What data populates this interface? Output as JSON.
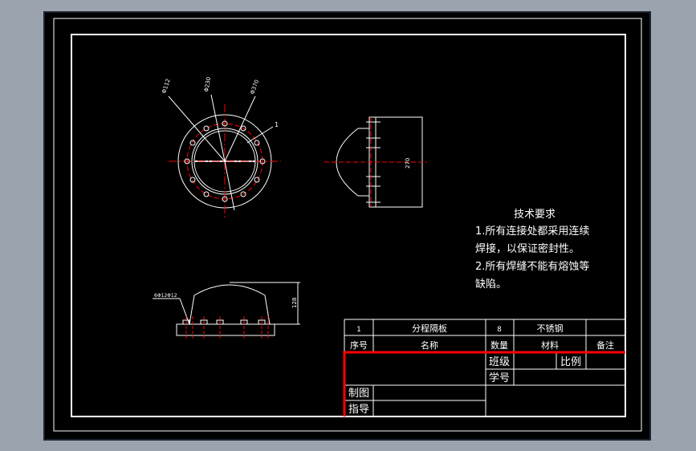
{
  "colors": {
    "viewer_background": "#9aa3ae",
    "sheet": "#000000",
    "lines": "#ffffff",
    "centerlines": "#ff0000",
    "highlight": "#ff0000"
  },
  "technical_requirements": {
    "title": "技术要求",
    "line1": "1.所有连接处都采用连续",
    "line2": "焊接，以保证密封性。",
    "line3": "2.所有焊缝不能有熔蚀等",
    "line4": "缺陷。"
  },
  "dimensions": {
    "top_left_1": "Φ112",
    "top_left_2": "Φ230",
    "top_left_3": "Φ370",
    "leader_1": "1",
    "side_height": "270",
    "front_height": "128",
    "front_leader": "6Φ12Φ12"
  },
  "parts_list": {
    "row1": {
      "seq": "1",
      "name": "分程隔板",
      "qty": "8",
      "material": "不锈钢",
      "remark": ""
    },
    "header": {
      "seq": "序号",
      "name": "名称",
      "qty": "数量",
      "material": "材料",
      "remark": "备注"
    }
  },
  "title_block": {
    "class_label": "班级",
    "scale_label": "比例",
    "student_no_label": "学号",
    "drawn_by_label": "制图",
    "guided_by_label": "指导"
  }
}
